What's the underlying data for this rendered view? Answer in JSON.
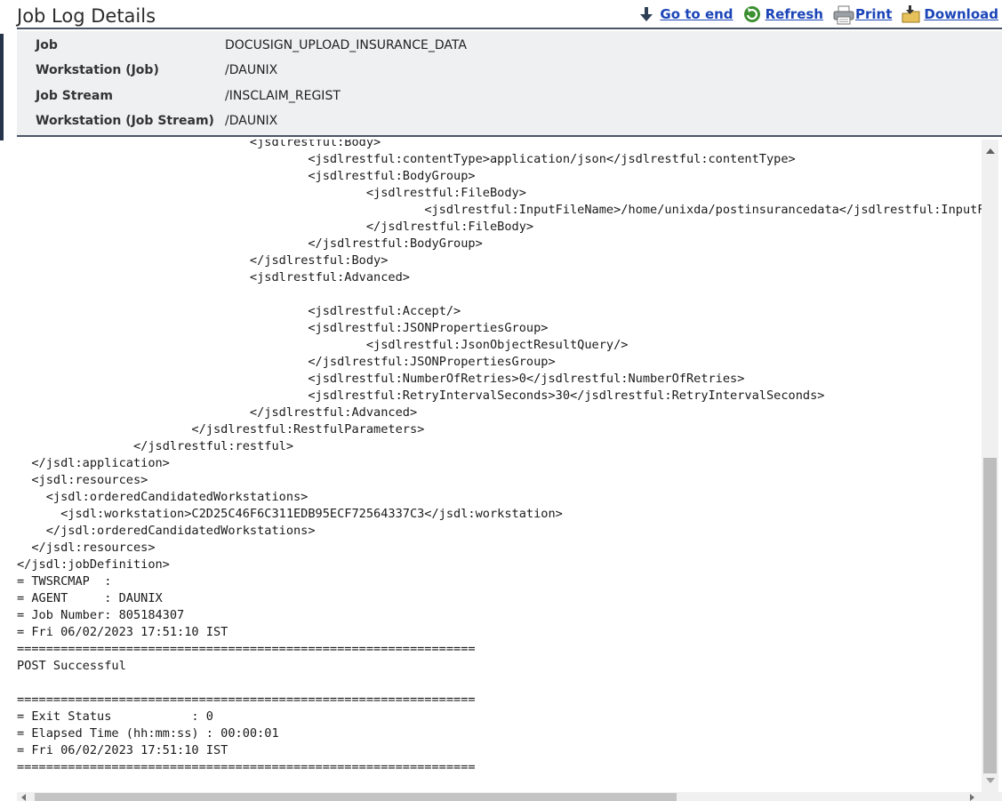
{
  "page": {
    "title": "Job Log Details"
  },
  "toolbar": {
    "goto_end_label": "Go to end",
    "refresh_label": "Refresh",
    "print_label": "Print",
    "download_label": "Download"
  },
  "properties": [
    {
      "key": "Job",
      "value": "DOCUSIGN_UPLOAD_INSURANCE_DATA"
    },
    {
      "key": "Workstation (Job)",
      "value": "/DAUNIX"
    },
    {
      "key": "Job Stream",
      "value": "/INSCLAIM_REGIST"
    },
    {
      "key": "Workstation (Job Stream)",
      "value": "/DAUNIX"
    }
  ],
  "log": {
    "lines": [
      "\t\t\t\t<jsdlrestful:Body>",
      "\t\t\t\t\t<jsdlrestful:contentType>application/json</jsdlrestful:contentType>",
      "\t\t\t\t\t<jsdlrestful:BodyGroup>",
      "\t\t\t\t\t\t<jsdlrestful:FileBody>",
      "\t\t\t\t\t\t\t<jsdlrestful:InputFileName>/home/unixda/postinsurancedata</jsdlrestful:InputFileName>",
      "\t\t\t\t\t\t</jsdlrestful:FileBody>",
      "\t\t\t\t\t</jsdlrestful:BodyGroup>",
      "\t\t\t\t</jsdlrestful:Body>",
      "\t\t\t\t<jsdlrestful:Advanced>",
      "",
      "\t\t\t\t\t<jsdlrestful:Accept/>",
      "\t\t\t\t\t<jsdlrestful:JSONPropertiesGroup>",
      "\t\t\t\t\t\t<jsdlrestful:JsonObjectResultQuery/>",
      "\t\t\t\t\t</jsdlrestful:JSONPropertiesGroup>",
      "\t\t\t\t\t<jsdlrestful:NumberOfRetries>0</jsdlrestful:NumberOfRetries>",
      "\t\t\t\t\t<jsdlrestful:RetryIntervalSeconds>30</jsdlrestful:RetryIntervalSeconds>",
      "\t\t\t\t</jsdlrestful:Advanced>",
      "\t\t\t</jsdlrestful:RestfulParameters>",
      "\t\t</jsdlrestful:restful>",
      "  </jsdl:application>",
      "  <jsdl:resources>",
      "    <jsdl:orderedCandidatedWorkstations>",
      "      <jsdl:workstation>C2D25C46F6C311EDB95ECF72564337C3</jsdl:workstation>",
      "    </jsdl:orderedCandidatedWorkstations>",
      "  </jsdl:resources>",
      "</jsdl:jobDefinition>",
      "= TWSRCMAP  :",
      "= AGENT     : DAUNIX",
      "= Job Number: 805184307",
      "= Fri 06/02/2023 17:51:10 IST",
      "===============================================================",
      "POST Successful",
      "",
      "===============================================================",
      "= Exit Status           : 0",
      "= Elapsed Time (hh:mm:ss) : 00:00:01",
      "= Fri 06/02/2023 17:51:10 IST",
      "==============================================================="
    ]
  },
  "icons": {
    "goto_end": "arrow-down-icon",
    "refresh": "refresh-icon",
    "print": "printer-icon",
    "download": "download-icon"
  },
  "colors": {
    "link": "#1b45b8",
    "header_rule": "#4a5566",
    "props_bg": "#eef0f2"
  }
}
